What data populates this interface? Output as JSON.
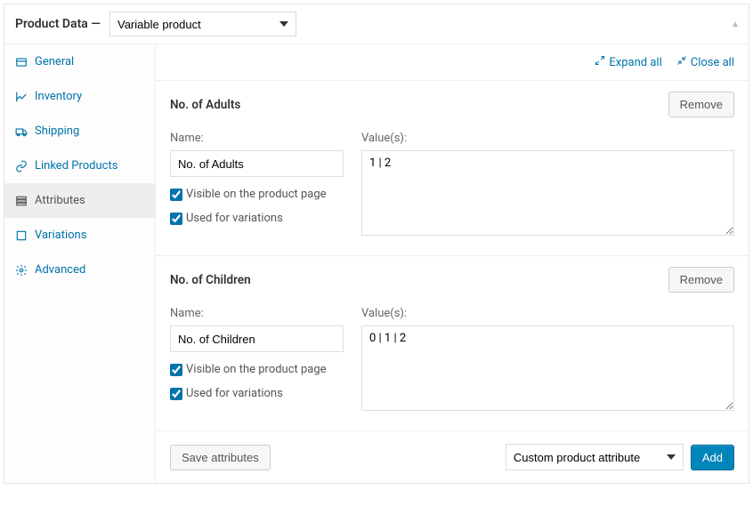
{
  "header": {
    "title": "Product Data —",
    "type_select": "Variable product"
  },
  "sidebar": {
    "items": [
      {
        "label": "General"
      },
      {
        "label": "Inventory"
      },
      {
        "label": "Shipping"
      },
      {
        "label": "Linked Products"
      },
      {
        "label": "Attributes"
      },
      {
        "label": "Variations"
      },
      {
        "label": "Advanced"
      }
    ]
  },
  "toolbar": {
    "expand": "Expand all",
    "close": "Close all"
  },
  "labels": {
    "name": "Name:",
    "values": "Value(s):",
    "visible": "Visible on the product page",
    "used": "Used for variations",
    "remove": "Remove",
    "save": "Save attributes",
    "add": "Add",
    "custom_attr": "Custom product attribute"
  },
  "attrs": [
    {
      "title": "No. of Adults",
      "name": "No. of Adults",
      "values": "1 | 2",
      "visible": true,
      "used": true
    },
    {
      "title": "No. of Children",
      "name": "No. of Children",
      "values": "0 | 1 | 2",
      "visible": true,
      "used": true
    }
  ]
}
